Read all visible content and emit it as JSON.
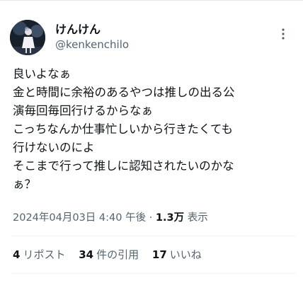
{
  "author": {
    "display_name": "けんけん",
    "handle": "@kenkenchilo"
  },
  "tweet": {
    "lines": [
      "良いよなぁ",
      "金と時間に余裕のあるやつは推しの出る公",
      "演毎回毎回行けるからなぁ",
      "こっちなんか仕事忙しいから行きたくても",
      "行けないのによ",
      "そこまで行って推しに認知されたいのかな",
      "ぁ？"
    ]
  },
  "meta": {
    "timestamp": "2024年04月03日 4:40 午後",
    "separator": "·",
    "views_count": "1.3万",
    "views_label": "表示"
  },
  "stats": {
    "reposts_count": "4",
    "reposts_label": "リポスト",
    "quotes_count": "34",
    "quotes_label": "件の引用",
    "likes_count": "17",
    "likes_label": "いいね"
  },
  "icons": {
    "more": "more-vertical-icon"
  },
  "colors": {
    "text_primary": "#0f1419",
    "text_secondary": "#536471",
    "divider": "#eff3f4"
  }
}
